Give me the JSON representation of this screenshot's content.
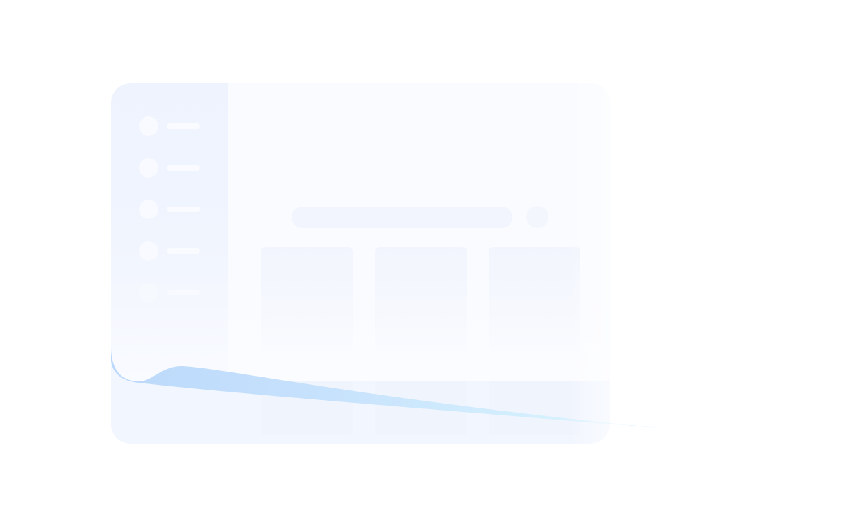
{
  "illustration": {
    "kind": "empty-state",
    "colors": {
      "background": "#ffffff",
      "window": "#f2f6fe",
      "sheet": "#f9fbff",
      "sidebar": "#eff3fe",
      "placeholder": "#f2f5fd",
      "curl_start": "#bcd9fb",
      "curl_end": "#d3effd"
    }
  },
  "sidebar": {
    "item_count": 5
  },
  "content": {
    "top_card_count": 3,
    "bottom_card_count": 3
  }
}
